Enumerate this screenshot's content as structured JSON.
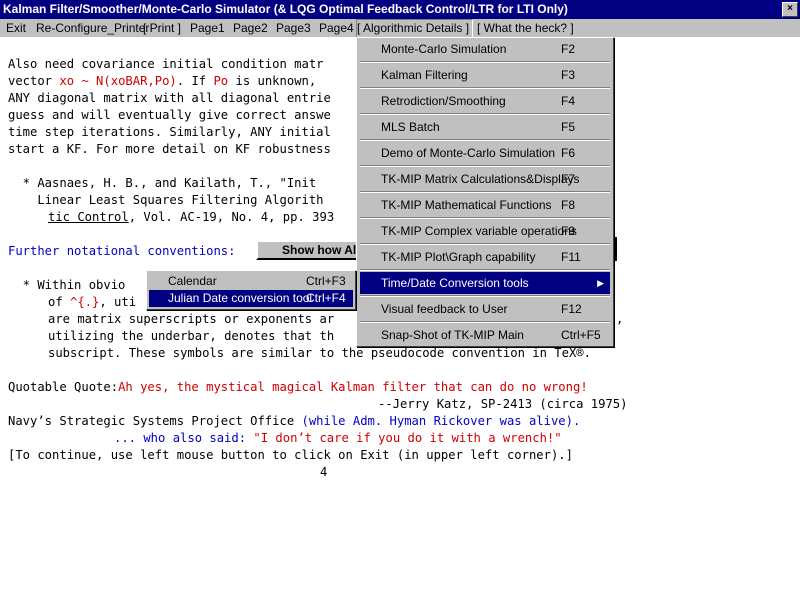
{
  "window": {
    "title": "Kalman Filter/Smoother/Monte-Carlo Simulator (& LQG Optimal Feedback Control/LTR for LTI Only)"
  },
  "menubar": {
    "items": [
      {
        "label": "Exit"
      },
      {
        "label": "Re-Configure_Printer"
      },
      {
        "label": "[ Print ]"
      },
      {
        "label": "Page1"
      },
      {
        "label": "Page2"
      },
      {
        "label": "Page3"
      },
      {
        "label": "Page4"
      },
      {
        "label": "[  Algorithmic Details  ]"
      },
      {
        "label": "[ What the heck? ]"
      }
    ]
  },
  "content": {
    "line1": "Also need covariance initial condition matr",
    "line2_a": "vector ",
    "line2_b": "xo ~ N(xoBAR,Po)",
    "line2_c": ". If ",
    "line2_d": "Po",
    "line2_e": " is unknown, ",
    "line3": "ANY diagonal matrix with all diagonal entrie",
    "line4": "guess and will eventually give correct answe",
    "line5": "time step iterations. Similarly, ANY initial",
    "line6": "start a KF. For more detail on KF robustness",
    "ref1": "  * Aasnaes, H. B., and Kailath, T., \"Init",
    "ref2": "    Linear Least Squares Filtering Algorith",
    "ref3_u": "tic Control",
    "ref3_b": ", Vol. AC-19, No. 4, pp. 393",
    "further": "Further notational conventions:",
    "show_button": "Show how Al",
    "within_a": "  * Within obvio",
    "of_a": "of ",
    "of_b": "^{.}",
    "of_c": ", uti",
    "are_a": "are matrix superscripts or exponents ar",
    "are_b": ",",
    "util_a": "utilizing the underbar, denotes that th",
    "subscript": "subscript. These symbols are similar to the pseudocode convention in TeX®.",
    "quote_label": "Quotable Quote:",
    "quote_text": "Ah yes, the mystical magical Kalman filter that can do no wrong!",
    "attrib": "--Jerry Katz, SP-2413 (circa 1975)",
    "navy_a": "Navy’s Strategic Systems Project Office ",
    "navy_b": "(while Adm. Hyman Rickover was alive).",
    "also_a": "... who also said: ",
    "also_b": "\"I don’t care if you do it with a wrench!\"",
    "continue": "[To continue, use left mouse button to click on Exit (in upper left corner).]",
    "page_number": "4"
  },
  "dropdown": {
    "items": [
      {
        "label": "Monte-Carlo Simulation",
        "shortcut": "F2"
      },
      {
        "label": "Kalman Filtering",
        "shortcut": "F3"
      },
      {
        "label": "Retrodiction/Smoothing",
        "shortcut": "F4"
      },
      {
        "label": "MLS Batch",
        "shortcut": "F5"
      },
      {
        "label": "Demo of Monte-Carlo Simulation",
        "shortcut": "F6"
      },
      {
        "label": "TK-MIP Matrix Calculations&Displays",
        "shortcut": "F7"
      },
      {
        "label": "TK-MIP Mathematical Functions",
        "shortcut": "F8"
      },
      {
        "label": "TK-MIP Complex variable operations",
        "shortcut": "F9"
      },
      {
        "label": "TK-MIP Plot\\Graph capability",
        "shortcut": "F11"
      },
      {
        "label": "Time/Date Conversion tools",
        "shortcut": ""
      },
      {
        "label": "Visual feedback to User",
        "shortcut": "F12"
      },
      {
        "label": "Snap-Shot of TK-MIP Main",
        "shortcut": "Ctrl+F5"
      }
    ]
  },
  "submenu": {
    "items": [
      {
        "label": "Calendar",
        "shortcut": "Ctrl+F3"
      },
      {
        "label": "Julian Date conversion tool",
        "shortcut": "Ctrl+F4"
      }
    ]
  },
  "colors": {
    "titlebar": "#000080",
    "highlight": "#000080",
    "red_text": "#d00000",
    "blue_text": "#0000c8",
    "menu_face": "#c0c0c0"
  }
}
